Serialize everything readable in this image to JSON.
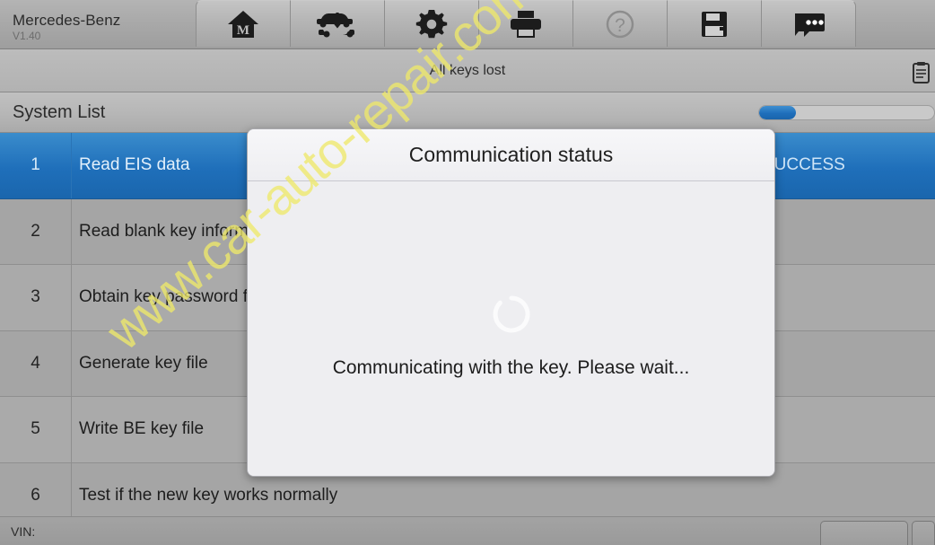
{
  "header": {
    "brand": "Mercedes-Benz",
    "version": "V1.40",
    "toolbar": [
      {
        "name": "home-icon",
        "label": "Home"
      },
      {
        "name": "vehicle-swap-icon",
        "label": "Vehicle"
      },
      {
        "name": "gear-icon",
        "label": "Settings"
      },
      {
        "name": "printer-icon",
        "label": "Print"
      },
      {
        "name": "help-icon",
        "label": "Help"
      },
      {
        "name": "save-icon",
        "label": "Save"
      },
      {
        "name": "feedback-icon",
        "label": "Feedback"
      }
    ]
  },
  "subbar": {
    "title": "All keys lost",
    "right_icon": "clipboard-icon"
  },
  "listbar": {
    "title": "System List",
    "progress_percent": 21
  },
  "table": {
    "rows": [
      {
        "index": "1",
        "name": "Read EIS data",
        "status": "SUCCESS"
      },
      {
        "index": "2",
        "name": "Read blank key information",
        "status": ""
      },
      {
        "index": "3",
        "name": "Obtain key password file",
        "status": ""
      },
      {
        "index": "4",
        "name": "Generate key file",
        "status": ""
      },
      {
        "index": "5",
        "name": "Write BE key file",
        "status": ""
      },
      {
        "index": "6",
        "name": "Test if the new key works normally",
        "status": ""
      }
    ]
  },
  "dialog": {
    "title": "Communication status",
    "message": "Communicating with the key. Please wait...",
    "spinner": "loading-spinner-icon"
  },
  "bottombar": {
    "vin_label": "VIN:"
  },
  "watermark": {
    "text": "www.car-auto-repair.com"
  },
  "colors": {
    "accent": "#1f6fbb",
    "watermark": "#efe96b",
    "background": "#a8a8a8"
  }
}
